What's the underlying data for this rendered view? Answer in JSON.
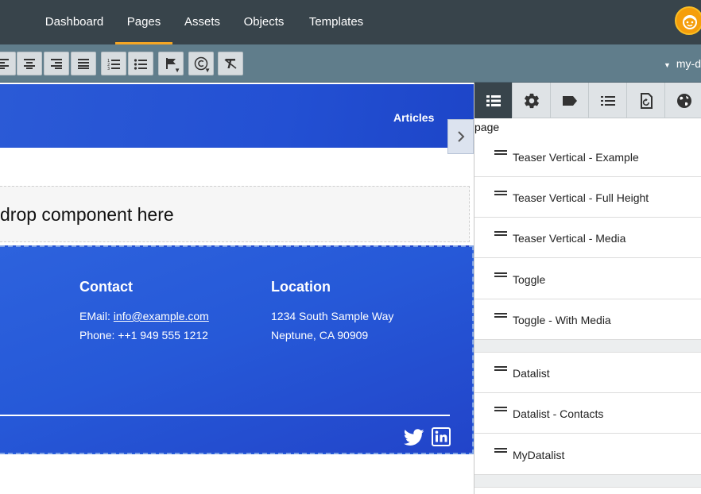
{
  "nav": {
    "tabs": [
      {
        "label": "Dashboard"
      },
      {
        "label": "Pages"
      },
      {
        "label": "Assets"
      },
      {
        "label": "Objects"
      },
      {
        "label": "Templates"
      }
    ],
    "active_tab": "Pages"
  },
  "toolbar": {
    "buttons": [
      "align-left-icon",
      "align-center-icon",
      "align-right-icon",
      "align-justify-icon",
      "ordered-list-icon",
      "bullet-list-icon",
      "flag-icon",
      "copyright-icon",
      "clear-format-icon"
    ],
    "site_label": "my-d"
  },
  "editor": {
    "hero_link": "Articles",
    "dropzone_text": "drop component here",
    "footer": {
      "contact_heading": "Contact",
      "email_prefix": "EMail: ",
      "email_link": "info@example.com",
      "phone": "Phone: ++1 949 555 1212",
      "location_heading": "Location",
      "address_line1": "1234 South Sample Way",
      "address_line2": "Neptune, CA 90909"
    }
  },
  "panel": {
    "path": "page",
    "group1": [
      {
        "label": "Teaser Vertical - Example"
      },
      {
        "label": "Teaser Vertical - Full Height"
      },
      {
        "label": "Teaser Vertical - Media"
      },
      {
        "label": "Toggle"
      },
      {
        "label": "Toggle - With Media"
      }
    ],
    "group2": [
      {
        "label": "Datalist"
      },
      {
        "label": "Datalist - Contacts"
      },
      {
        "label": "MyDatalist"
      }
    ]
  },
  "colors": {
    "nav_bg": "#38444b",
    "toolbar_bg": "#607d8b",
    "accent": "#f5a623",
    "brand_blue": "#2350d3"
  }
}
